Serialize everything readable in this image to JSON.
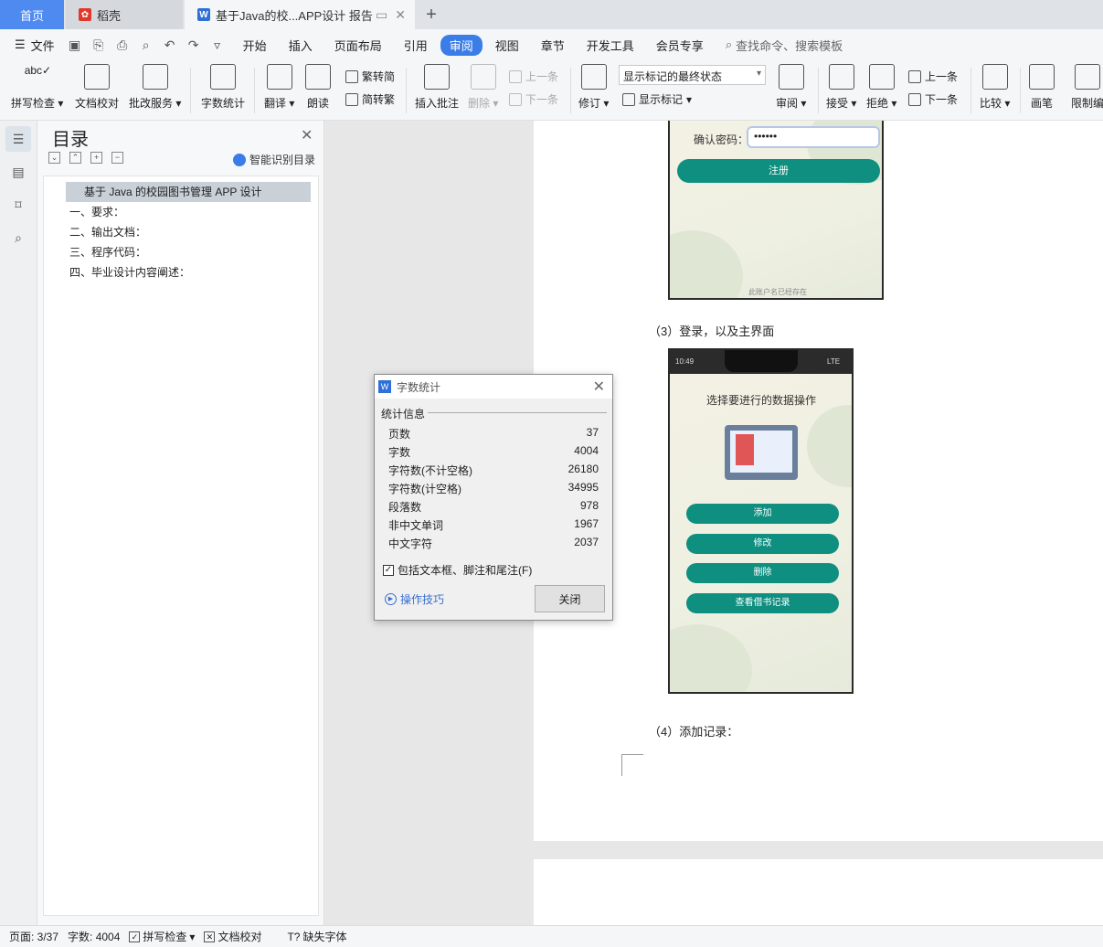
{
  "tabs": {
    "home": "首页",
    "docer": "稻壳",
    "document": "基于Java的校...APP设计 报告"
  },
  "menu": {
    "file": "文件",
    "items": [
      "开始",
      "插入",
      "页面布局",
      "引用",
      "审阅",
      "视图",
      "章节",
      "开发工具",
      "会员专享"
    ],
    "active": "审阅",
    "search": "查找命令、搜索模板"
  },
  "ribbon": {
    "spell_check": "拼写检查",
    "doc_proof": "文档校对",
    "correction_service": "批改服务",
    "word_count": "字数统计",
    "translate": "翻译",
    "read_aloud": "朗读",
    "trad_to_simp": "繁转简",
    "simp_to_trad": "简转繁",
    "insert_comment": "插入批注",
    "delete": "删除",
    "prev_comment": "上一条",
    "next_comment": "下一条",
    "track_changes": "修订",
    "markup_state": "显示标记的最终状态",
    "show_markup": "显示标记",
    "review": "审阅",
    "accept": "接受",
    "reject": "拒绝",
    "prev_change": "上一条",
    "next_change": "下一条",
    "compare": "比较",
    "pen": "画笔",
    "restrict": "限制编"
  },
  "toc": {
    "title": "目录",
    "smart": "智能识别目录",
    "items": [
      "基于 Java 的校园图书管理 APP 设计",
      "一、要求：",
      "二、输出文档：",
      "三、程序代码：",
      "四、毕业设计内容阐述："
    ]
  },
  "document": {
    "confirm_password_label": "确认密码：",
    "password_dots": "••••••",
    "register_button": "注册",
    "user_exists_msg": "此账户名已经存在",
    "caption3": "（3）登录，以及主界面",
    "phone_time": "10:49",
    "phone_signal": "LTE",
    "operation_title": "选择要进行的数据操作",
    "buttons": [
      "添加",
      "修改",
      "删除",
      "查看借书记录"
    ],
    "caption4": "（4）添加记录："
  },
  "dialog": {
    "title": "字数统计",
    "group": "统计信息",
    "stats": [
      {
        "label": "页数",
        "value": "37"
      },
      {
        "label": "字数",
        "value": "4004"
      },
      {
        "label": "字符数(不计空格)",
        "value": "26180"
      },
      {
        "label": "字符数(计空格)",
        "value": "34995"
      },
      {
        "label": "段落数",
        "value": "978"
      },
      {
        "label": "非中文单词",
        "value": "1967"
      },
      {
        "label": "中文字符",
        "value": "2037"
      }
    ],
    "include_label": "包括文本框、脚注和尾注(F)",
    "include_checked": true,
    "tips": "操作技巧",
    "close": "关闭"
  },
  "status": {
    "page": "页面: 3/37",
    "words": "字数: 4004",
    "spell": "拼写检查",
    "proof": "文档校对",
    "missing_font": "缺失字体"
  },
  "colors": {
    "accent": "#3a7de8",
    "teal_button": "#0f8f80"
  }
}
